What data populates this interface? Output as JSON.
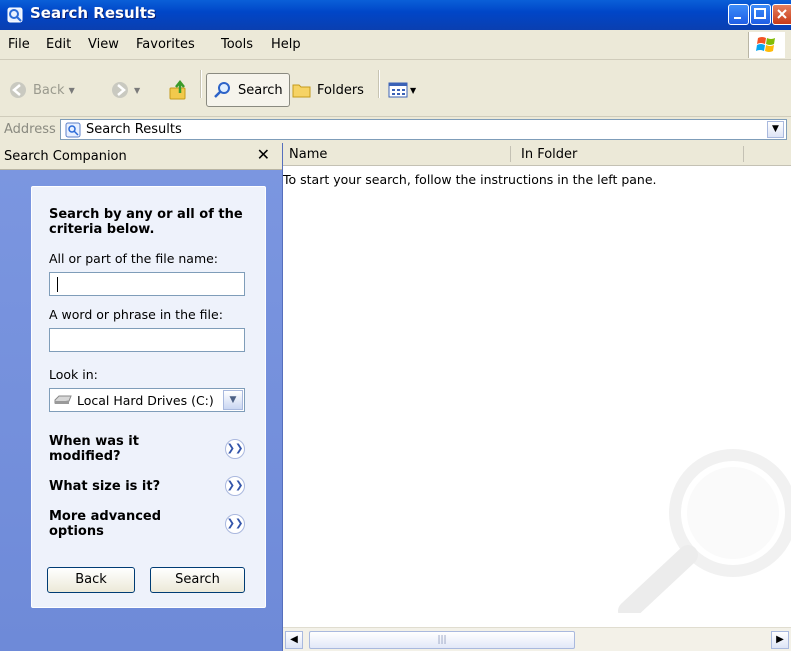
{
  "window": {
    "title": "Search Results"
  },
  "menu": [
    "File",
    "Edit",
    "View",
    "Favorites",
    "Tools",
    "Help"
  ],
  "toolbar": {
    "back_label": "Back",
    "search_label": "Search",
    "folders_label": "Folders"
  },
  "address": {
    "label": "Address",
    "value": "Search Results"
  },
  "companion": {
    "header": "Search Companion",
    "close_glyph": "✕",
    "title": "Search by any or all of the criteria below.",
    "filename_label": "All or part of the file name:",
    "filename_value": "",
    "phrase_label": "A word or phrase in the file:",
    "phrase_value": "",
    "lookin_label": "Look in:",
    "lookin_value": "Local Hard Drives (C:)",
    "sections": [
      "When was it modified?",
      "What size is it?",
      "More advanced options"
    ],
    "back_button": "Back",
    "search_button": "Search"
  },
  "results": {
    "columns": [
      "Name",
      "In Folder"
    ],
    "message": "To start your search, follow the instructions in the left pane."
  },
  "colors": {
    "titlebar": "#0a5fd8",
    "pane_background": "#7a96df",
    "panel_background": "#eef2fb"
  }
}
